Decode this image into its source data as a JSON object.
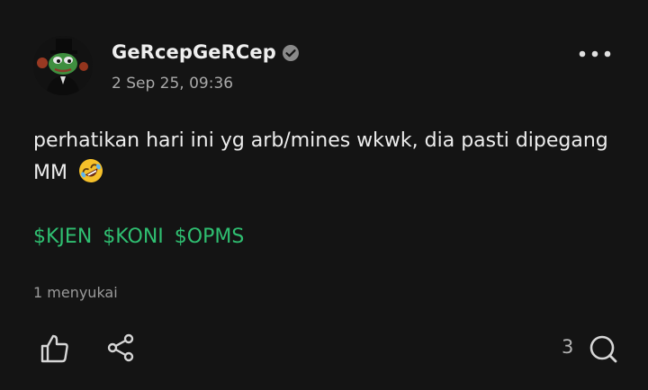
{
  "author": {
    "name": "GeRcepGeRCep",
    "verified": true,
    "avatar_icon": "pepe-frog-avatar",
    "timestamp": "2 Sep 25, 09:36"
  },
  "post": {
    "text": "perhatikan hari ini yg arb/mines wkwk, dia pasti dipegang MM",
    "emoji_icon": "rolling-on-floor-laughing-emoji",
    "tickers": [
      "$KJEN",
      "$KONI",
      "$OPMS"
    ],
    "likes_text": "1 menyukai"
  },
  "actions": {
    "comment_count": "3",
    "like_icon": "thumbs-up-icon",
    "share_icon": "share-icon",
    "comment_icon": "comment-icon",
    "more_icon": "more-horizontal-icon"
  },
  "colors": {
    "background": "#141414",
    "ticker": "#2fbf71",
    "secondary_text": "#a9a9a9"
  }
}
